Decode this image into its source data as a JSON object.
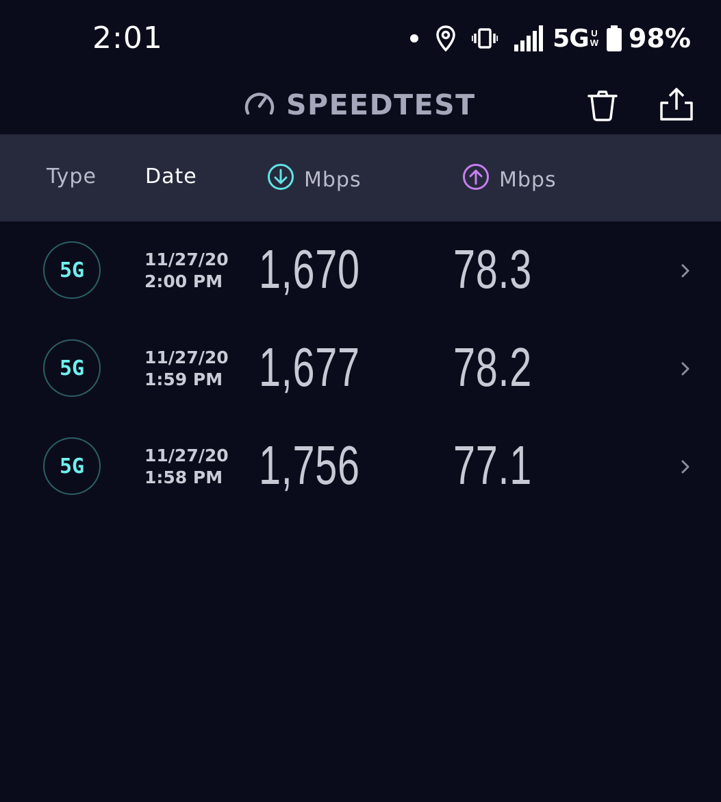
{
  "status_bar": {
    "time": "2:01",
    "network": "5G",
    "network_sub_top": "U",
    "network_sub_bottom": "W",
    "battery": "98%"
  },
  "header": {
    "title": "SPEEDTEST",
    "icons": [
      "speedometer-icon",
      "trash-icon",
      "share-icon"
    ]
  },
  "table": {
    "columns": {
      "type": "Type",
      "date": "Date",
      "download": "Mbps",
      "upload": "Mbps"
    },
    "rows": [
      {
        "type": "5G",
        "date": "11/27/20",
        "time": "2:00 PM",
        "download": "1,670",
        "upload": "78.3"
      },
      {
        "type": "5G",
        "date": "11/27/20",
        "time": "1:59 PM",
        "download": "1,677",
        "upload": "78.2"
      },
      {
        "type": "5G",
        "date": "11/27/20",
        "time": "1:58 PM",
        "download": "1,756",
        "upload": "77.1"
      }
    ]
  },
  "colors": {
    "background": "#0b0c1b",
    "header_band": "#272a3d",
    "download_accent": "#5fe4e6",
    "upload_accent": "#c77ff0",
    "badge_text": "#6ff0ee"
  }
}
